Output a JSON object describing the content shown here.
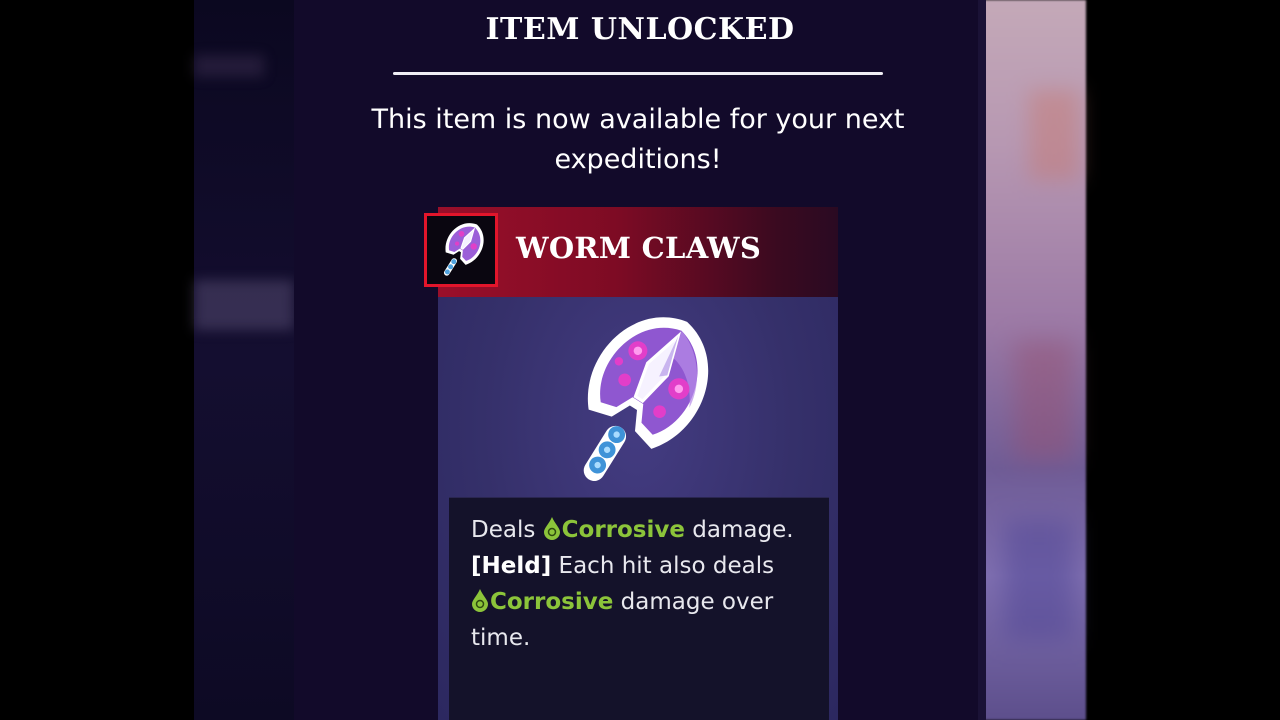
{
  "header": {
    "title": "ITEM UNLOCKED",
    "subtitle_line1": "This item is now available for your next",
    "subtitle_line2": "expeditions!"
  },
  "item": {
    "name": "WORM CLAWS",
    "icon": "worm-claws-icon",
    "description": {
      "l1_pre": "Deals ",
      "l1_kw": "Corrosive",
      "l1_post": " damage.",
      "l2_tag": "[Held]",
      "l2_post": " Each hit also deals",
      "l3_kw": "Corrosive",
      "l3_post": " damage over",
      "l4": "time."
    }
  },
  "colors": {
    "keyword": "#8cc43a",
    "header_red": "#9a0f2a",
    "panel_bg": "#120a2a",
    "thumb_border": "#e2152b"
  }
}
